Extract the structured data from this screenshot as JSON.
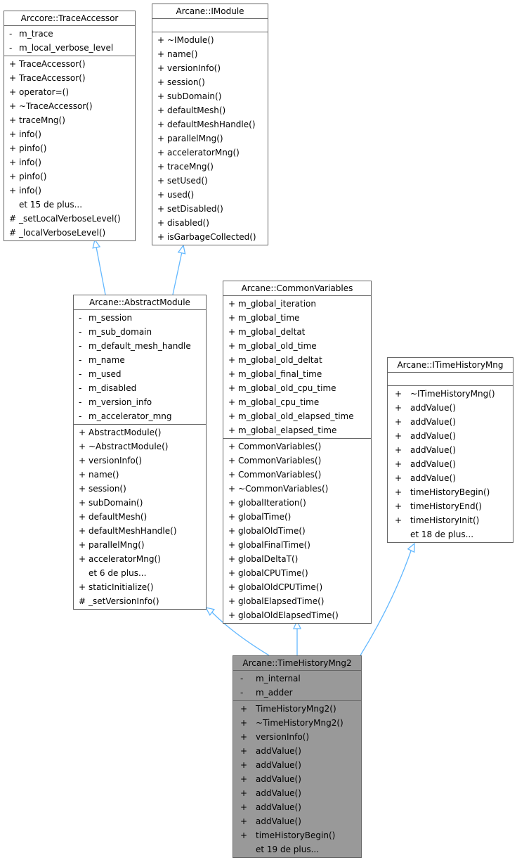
{
  "classes": {
    "trace_accessor": {
      "name": "Arccore::TraceAccessor",
      "attributes": [
        {
          "vis": "-",
          "name": "m_trace"
        },
        {
          "vis": "-",
          "name": "m_local_verbose_level"
        }
      ],
      "methods": [
        {
          "vis": "+",
          "name": "TraceAccessor()"
        },
        {
          "vis": "+",
          "name": "TraceAccessor()"
        },
        {
          "vis": "+",
          "name": "operator=()"
        },
        {
          "vis": "+",
          "name": "~TraceAccessor()"
        },
        {
          "vis": "+",
          "name": "traceMng()"
        },
        {
          "vis": "+",
          "name": "info()"
        },
        {
          "vis": "+",
          "name": "pinfo()"
        },
        {
          "vis": "+",
          "name": "info()"
        },
        {
          "vis": "+",
          "name": "pinfo()"
        },
        {
          "vis": "+",
          "name": "info()"
        },
        {
          "vis": "",
          "name": "et 15 de plus..."
        },
        {
          "vis": "#",
          "name": "_setLocalVerboseLevel()"
        },
        {
          "vis": "#",
          "name": "_localVerboseLevel()"
        }
      ]
    },
    "imodule": {
      "name": "Arcane::IModule",
      "attributes": [],
      "methods": [
        {
          "vis": "+",
          "name": "~IModule()"
        },
        {
          "vis": "+",
          "name": "name()"
        },
        {
          "vis": "+",
          "name": "versionInfo()"
        },
        {
          "vis": "+",
          "name": "session()"
        },
        {
          "vis": "+",
          "name": "subDomain()"
        },
        {
          "vis": "+",
          "name": "defaultMesh()"
        },
        {
          "vis": "+",
          "name": "defaultMeshHandle()"
        },
        {
          "vis": "+",
          "name": "parallelMng()"
        },
        {
          "vis": "+",
          "name": "acceleratorMng()"
        },
        {
          "vis": "+",
          "name": "traceMng()"
        },
        {
          "vis": "+",
          "name": "setUsed()"
        },
        {
          "vis": "+",
          "name": "used()"
        },
        {
          "vis": "+",
          "name": "setDisabled()"
        },
        {
          "vis": "+",
          "name": "disabled()"
        },
        {
          "vis": "+",
          "name": "isGarbageCollected()"
        }
      ]
    },
    "abstract_module": {
      "name": "Arcane::AbstractModule",
      "attributes": [
        {
          "vis": "-",
          "name": "m_session"
        },
        {
          "vis": "-",
          "name": "m_sub_domain"
        },
        {
          "vis": "-",
          "name": "m_default_mesh_handle"
        },
        {
          "vis": "-",
          "name": "m_name"
        },
        {
          "vis": "-",
          "name": "m_used"
        },
        {
          "vis": "-",
          "name": "m_disabled"
        },
        {
          "vis": "-",
          "name": "m_version_info"
        },
        {
          "vis": "-",
          "name": "m_accelerator_mng"
        }
      ],
      "methods": [
        {
          "vis": "+",
          "name": "AbstractModule()"
        },
        {
          "vis": "+",
          "name": "~AbstractModule()"
        },
        {
          "vis": "+",
          "name": "versionInfo()"
        },
        {
          "vis": "+",
          "name": "name()"
        },
        {
          "vis": "+",
          "name": "session()"
        },
        {
          "vis": "+",
          "name": "subDomain()"
        },
        {
          "vis": "+",
          "name": "defaultMesh()"
        },
        {
          "vis": "+",
          "name": "defaultMeshHandle()"
        },
        {
          "vis": "+",
          "name": "parallelMng()"
        },
        {
          "vis": "+",
          "name": "acceleratorMng()"
        },
        {
          "vis": "",
          "name": "et 6 de plus..."
        },
        {
          "vis": "+",
          "name": "staticInitialize()"
        },
        {
          "vis": "#",
          "name": "_setVersionInfo()"
        }
      ]
    },
    "common_variables": {
      "name": "Arcane::CommonVariables",
      "attributes": [
        {
          "vis": "+",
          "name": "m_global_iteration"
        },
        {
          "vis": "+",
          "name": "m_global_time"
        },
        {
          "vis": "+",
          "name": "m_global_deltat"
        },
        {
          "vis": "+",
          "name": "m_global_old_time"
        },
        {
          "vis": "+",
          "name": "m_global_old_deltat"
        },
        {
          "vis": "+",
          "name": "m_global_final_time"
        },
        {
          "vis": "+",
          "name": "m_global_old_cpu_time"
        },
        {
          "vis": "+",
          "name": "m_global_cpu_time"
        },
        {
          "vis": "+",
          "name": "m_global_old_elapsed_time"
        },
        {
          "vis": "+",
          "name": "m_global_elapsed_time"
        }
      ],
      "methods": [
        {
          "vis": "+",
          "name": "CommonVariables()"
        },
        {
          "vis": "+",
          "name": "CommonVariables()"
        },
        {
          "vis": "+",
          "name": "CommonVariables()"
        },
        {
          "vis": "+",
          "name": "~CommonVariables()"
        },
        {
          "vis": "+",
          "name": "globalIteration()"
        },
        {
          "vis": "+",
          "name": "globalTime()"
        },
        {
          "vis": "+",
          "name": "globalOldTime()"
        },
        {
          "vis": "+",
          "name": "globalFinalTime()"
        },
        {
          "vis": "+",
          "name": "globalDeltaT()"
        },
        {
          "vis": "+",
          "name": "globalCPUTime()"
        },
        {
          "vis": "+",
          "name": "globalOldCPUTime()"
        },
        {
          "vis": "+",
          "name": "globalElapsedTime()"
        },
        {
          "vis": "+",
          "name": "globalOldElapsedTime()"
        }
      ]
    },
    "itime_history_mng": {
      "name": "Arcane::ITimeHistoryMng",
      "attributes": [],
      "methods": [
        {
          "vis": "+",
          "name": "~ITimeHistoryMng()"
        },
        {
          "vis": "+",
          "name": "addValue()"
        },
        {
          "vis": "+",
          "name": "addValue()"
        },
        {
          "vis": "+",
          "name": "addValue()"
        },
        {
          "vis": "+",
          "name": "addValue()"
        },
        {
          "vis": "+",
          "name": "addValue()"
        },
        {
          "vis": "+",
          "name": "addValue()"
        },
        {
          "vis": "+",
          "name": "timeHistoryBegin()"
        },
        {
          "vis": "+",
          "name": "timeHistoryEnd()"
        },
        {
          "vis": "+",
          "name": "timeHistoryInit()"
        },
        {
          "vis": "",
          "name": "et 18 de plus..."
        }
      ]
    },
    "time_history_mng2": {
      "name": "Arcane::TimeHistoryMng2",
      "attributes": [
        {
          "vis": "-",
          "name": "m_internal"
        },
        {
          "vis": "-",
          "name": "m_adder"
        }
      ],
      "methods": [
        {
          "vis": "+",
          "name": "TimeHistoryMng2()"
        },
        {
          "vis": "+",
          "name": "~TimeHistoryMng2()"
        },
        {
          "vis": "+",
          "name": "versionInfo()"
        },
        {
          "vis": "+",
          "name": "addValue()"
        },
        {
          "vis": "+",
          "name": "addValue()"
        },
        {
          "vis": "+",
          "name": "addValue()"
        },
        {
          "vis": "+",
          "name": "addValue()"
        },
        {
          "vis": "+",
          "name": "addValue()"
        },
        {
          "vis": "+",
          "name": "addValue()"
        },
        {
          "vis": "+",
          "name": "timeHistoryBegin()"
        },
        {
          "vis": "",
          "name": "et 19 de plus..."
        }
      ]
    }
  },
  "inheritance": [
    {
      "child": "abstract_module",
      "parent": "trace_accessor"
    },
    {
      "child": "abstract_module",
      "parent": "imodule"
    },
    {
      "child": "time_history_mng2",
      "parent": "abstract_module"
    },
    {
      "child": "time_history_mng2",
      "parent": "common_variables"
    },
    {
      "child": "time_history_mng2",
      "parent": "itime_history_mng"
    }
  ],
  "colors": {
    "edge": "#63b8ff",
    "border": "#666666",
    "focus_fill": "#999999"
  }
}
